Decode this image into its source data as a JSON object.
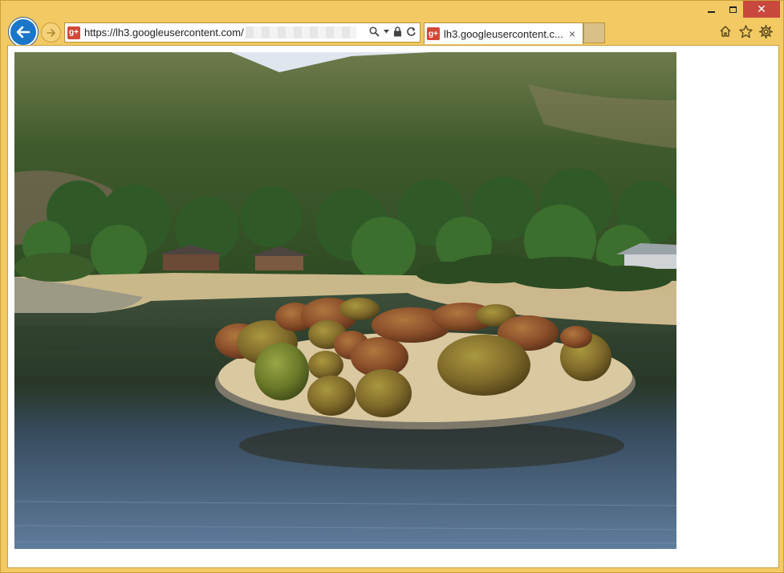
{
  "browser": {
    "address_bar": {
      "url_visible": "https://lh3.googleusercontent.com/"
    },
    "tab": {
      "title": "lh3.googleusercontent.c...",
      "close_glyph": "×"
    },
    "favicon_text": "g+",
    "window_controls": {
      "close_glyph": "✕"
    }
  },
  "colors": {
    "frame": "#f2c962",
    "back_button": "#1a76c9",
    "close_button": "#c9483d",
    "favicon": "#d34836"
  },
  "icons": [
    "back-arrow-icon",
    "forward-arrow-icon",
    "search-icon",
    "dropdown-icon",
    "lock-icon",
    "refresh-icon",
    "home-icon",
    "favorites-star-icon",
    "settings-gear-icon"
  ]
}
